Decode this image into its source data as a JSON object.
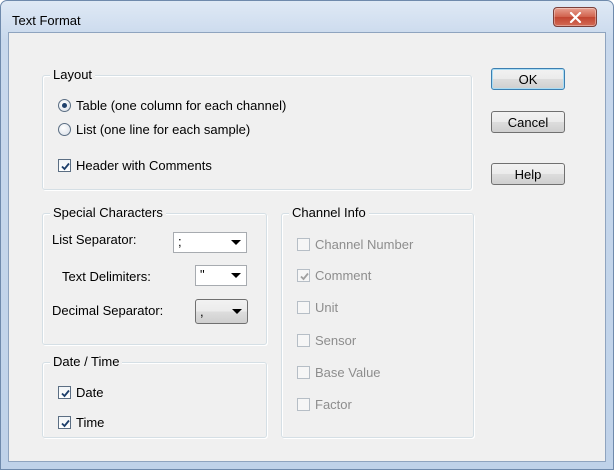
{
  "window": {
    "title": "Text Format"
  },
  "layout_group": {
    "legend": "Layout",
    "radio_table": {
      "label": "Table (one column for each channel)",
      "checked": true
    },
    "radio_list": {
      "label": "List (one line for each sample)",
      "checked": false
    },
    "header_comments": {
      "label": "Header with Comments",
      "checked": true
    }
  },
  "special_chars": {
    "legend": "Special Characters",
    "list_separator": {
      "label": "List Separator:",
      "value": ";"
    },
    "text_delimiters": {
      "label": "Text Delimiters:",
      "value": "\""
    },
    "decimal_separator": {
      "label": "Decimal Separator:",
      "value": ","
    }
  },
  "date_time": {
    "legend": "Date / Time",
    "date": {
      "label": "Date",
      "checked": true
    },
    "time": {
      "label": "Time",
      "checked": true
    }
  },
  "channel_info": {
    "legend": "Channel Info",
    "items": [
      {
        "label": "Channel Number",
        "checked": false,
        "enabled": false
      },
      {
        "label": "Comment",
        "checked": true,
        "enabled": false
      },
      {
        "label": "Unit",
        "checked": false,
        "enabled": false
      },
      {
        "label": "Sensor",
        "checked": false,
        "enabled": false
      },
      {
        "label": "Base Value",
        "checked": false,
        "enabled": false
      },
      {
        "label": "Factor",
        "checked": false,
        "enabled": false
      }
    ]
  },
  "buttons": {
    "ok": "OK",
    "cancel": "Cancel",
    "help": "Help"
  },
  "icons": {
    "close": "close-icon",
    "dropdown": "chevron-down-icon",
    "check": "checkmark-icon"
  }
}
